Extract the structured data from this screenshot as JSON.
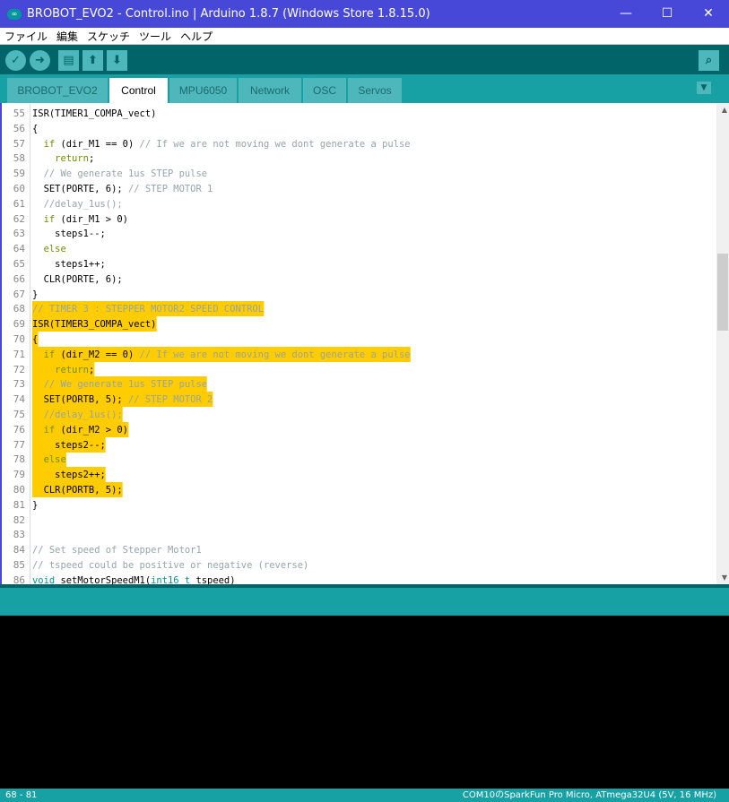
{
  "window": {
    "title": "BROBOT_EVO2 - Control.ino | Arduino 1.8.7 (Windows Store 1.8.15.0)",
    "minimize": "—",
    "maximize": "☐",
    "close": "✕"
  },
  "menu": [
    "ファイル",
    "編集",
    "スケッチ",
    "ツール",
    "ヘルプ"
  ],
  "toolbar": {
    "verify": "✓",
    "upload": "➜",
    "new": "▤",
    "open": "⬆",
    "save": "⬇",
    "serial_monitor": "⌕"
  },
  "tabs": [
    {
      "label": "BROBOT_EVO2"
    },
    {
      "label": "Control",
      "active": true
    },
    {
      "label": "MPU6050"
    },
    {
      "label": "Network"
    },
    {
      "label": "OSC"
    },
    {
      "label": "Servos"
    }
  ],
  "tab_menu": "▼",
  "colors": {
    "highlight": "#ffcc00",
    "keyword": "#728e00",
    "comment": "#95a5a6",
    "type": "#00979c",
    "toolbar": "#006468",
    "tabbar": "#17a1a5"
  },
  "editor": {
    "lines": [
      {
        "num": "55",
        "segs": [
          [
            "ISR(TIMER1_COMPA_vect)"
          ]
        ]
      },
      {
        "num": "56",
        "segs": [
          [
            "{"
          ]
        ]
      },
      {
        "num": "57",
        "segs": [
          [
            "  "
          ],
          [
            "if",
            "kw"
          ],
          [
            " (dir_M1 == 0) "
          ],
          [
            "// If we are not moving we dont generate a pulse",
            "cm"
          ]
        ]
      },
      {
        "num": "58",
        "segs": [
          [
            "    "
          ],
          [
            "return",
            "kw"
          ],
          [
            ";"
          ]
        ]
      },
      {
        "num": "59",
        "segs": [
          [
            "  "
          ],
          [
            "// We generate 1us STEP pulse",
            "cm"
          ]
        ]
      },
      {
        "num": "60",
        "segs": [
          [
            "  SET(PORTE, 6); "
          ],
          [
            "// STEP MOTOR 1",
            "cm"
          ]
        ]
      },
      {
        "num": "61",
        "segs": [
          [
            "  "
          ],
          [
            "//delay_1us();",
            "cm"
          ]
        ]
      },
      {
        "num": "62",
        "segs": [
          [
            "  "
          ],
          [
            "if",
            "kw"
          ],
          [
            " (dir_M1 > 0)"
          ]
        ]
      },
      {
        "num": "63",
        "segs": [
          [
            "    steps1--;"
          ]
        ]
      },
      {
        "num": "64",
        "segs": [
          [
            "  "
          ],
          [
            "else",
            "kw"
          ]
        ]
      },
      {
        "num": "65",
        "segs": [
          [
            "    steps1++;"
          ]
        ]
      },
      {
        "num": "66",
        "segs": [
          [
            "  CLR(PORTE, 6);"
          ]
        ]
      },
      {
        "num": "67",
        "segs": [
          [
            "}"
          ]
        ]
      },
      {
        "num": "68",
        "hl": true,
        "segs": [
          [
            "// TIMER 3 : STEPPER MOTOR2 SPEED CONTROL",
            "cm"
          ]
        ]
      },
      {
        "num": "69",
        "hl": true,
        "segs": [
          [
            "ISR(TIMER3_COMPA_vect)"
          ]
        ]
      },
      {
        "num": "70",
        "hl": true,
        "segs": [
          [
            "{"
          ]
        ]
      },
      {
        "num": "71",
        "hl": true,
        "segs": [
          [
            "  "
          ],
          [
            "if",
            "kw"
          ],
          [
            " (dir_M2 == 0) "
          ],
          [
            "// If we are not moving we dont generate a pulse",
            "cm"
          ]
        ]
      },
      {
        "num": "72",
        "hl": true,
        "segs": [
          [
            "    "
          ],
          [
            "return",
            "kw"
          ],
          [
            ";"
          ]
        ]
      },
      {
        "num": "73",
        "hl": true,
        "segs": [
          [
            "  "
          ],
          [
            "// We generate 1us STEP pulse",
            "cm"
          ]
        ]
      },
      {
        "num": "74",
        "hl": true,
        "segs": [
          [
            "  SET(PORTB, 5); "
          ],
          [
            "// STEP MOTOR 2",
            "cm"
          ]
        ]
      },
      {
        "num": "75",
        "hl": true,
        "segs": [
          [
            "  "
          ],
          [
            "//delay_1us();",
            "cm"
          ]
        ]
      },
      {
        "num": "76",
        "hl": true,
        "segs": [
          [
            "  "
          ],
          [
            "if",
            "kw"
          ],
          [
            " (dir_M2 > 0)"
          ]
        ]
      },
      {
        "num": "77",
        "hl": true,
        "segs": [
          [
            "    steps2--;"
          ]
        ]
      },
      {
        "num": "78",
        "hl": true,
        "segs": [
          [
            "  "
          ],
          [
            "else",
            "kw"
          ]
        ]
      },
      {
        "num": "79",
        "hl": true,
        "segs": [
          [
            "    steps2++;"
          ]
        ]
      },
      {
        "num": "80",
        "hl": true,
        "segs": [
          [
            "  CLR(PORTB, 5);"
          ]
        ]
      },
      {
        "num": "81",
        "segs": [
          [
            "}"
          ]
        ]
      },
      {
        "num": "82",
        "segs": [
          [
            ""
          ]
        ]
      },
      {
        "num": "83",
        "segs": [
          [
            ""
          ]
        ]
      },
      {
        "num": "84",
        "segs": [
          [
            "// Set speed of Stepper Motor1",
            "cm"
          ]
        ]
      },
      {
        "num": "85",
        "segs": [
          [
            "// tspeed could be positive or negative (reverse)",
            "cm"
          ]
        ]
      },
      {
        "num": "86",
        "segs": [
          [
            "void",
            "ty"
          ],
          [
            " setMotorSpeedM1("
          ],
          [
            "int16_t",
            "ty"
          ],
          [
            " tspeed)"
          ]
        ]
      }
    ]
  },
  "status": {
    "lines": "68 - 81",
    "board": "COM10のSparkFun Pro Micro, ATmega32U4 (5V, 16 MHz)"
  }
}
